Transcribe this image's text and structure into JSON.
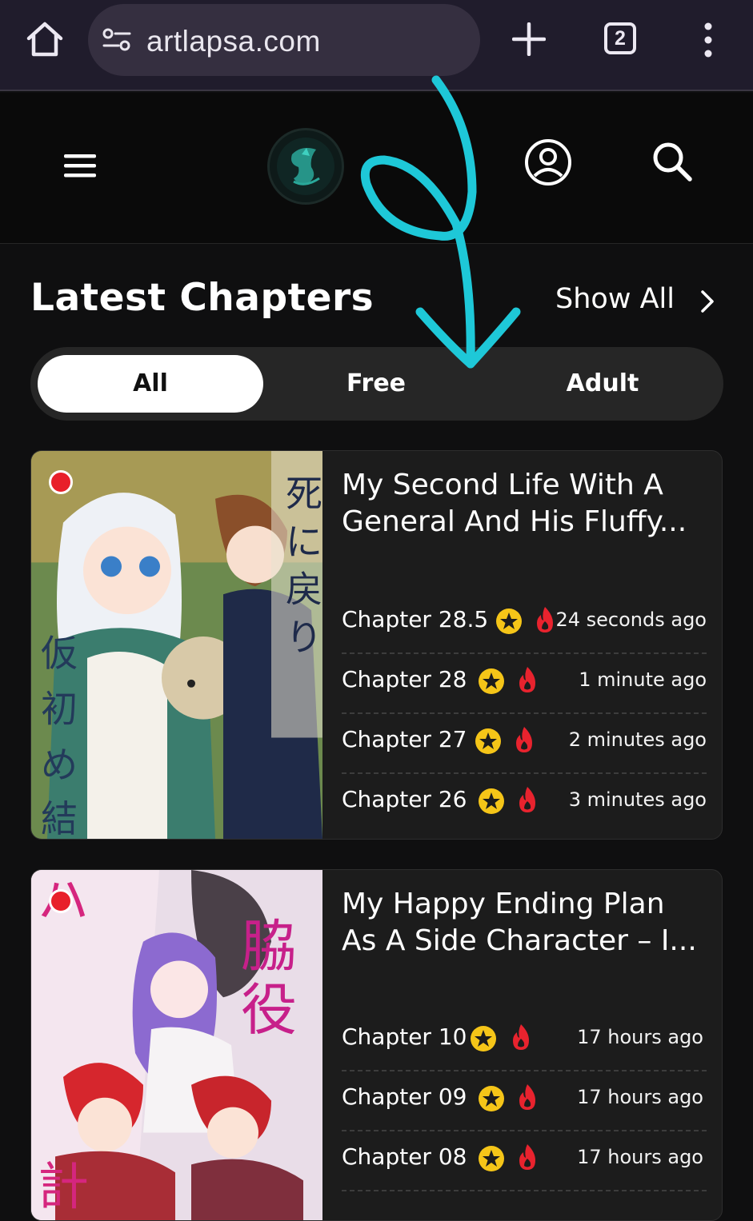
{
  "browser": {
    "url": "artlapsa.com",
    "tab_count": "2",
    "icons": [
      "home-icon",
      "site-settings-icon",
      "plus-icon",
      "tabs-icon",
      "more-vert-icon"
    ]
  },
  "header": {
    "icons": [
      "hamburger-menu-icon",
      "site-logo",
      "account-icon",
      "search-icon"
    ]
  },
  "section": {
    "title": "Latest Chapters",
    "show_all": "Show All"
  },
  "filters": {
    "tabs": [
      {
        "label": "All",
        "active": true
      },
      {
        "label": "Free",
        "active": false
      },
      {
        "label": "Adult",
        "active": false
      }
    ]
  },
  "series": [
    {
      "title": "My Second Life With A General And His Fluffy...",
      "chapters": [
        {
          "label": "Chapter 28.5",
          "time": "24 seconds ago"
        },
        {
          "label": "Chapter 28",
          "time": "1 minute ago"
        },
        {
          "label": "Chapter 27",
          "time": "2 minutes ago"
        },
        {
          "label": "Chapter 26",
          "time": "3 minutes ago"
        }
      ]
    },
    {
      "title": "My Happy Ending Plan As A Side Character – I...",
      "chapters": [
        {
          "label": "Chapter 10",
          "time": "17 hours ago"
        },
        {
          "label": "Chapter 09",
          "time": "17 hours ago"
        },
        {
          "label": "Chapter 08",
          "time": "17 hours ago"
        }
      ]
    }
  ],
  "colors": {
    "background": "#0f0f10",
    "browser_bar": "#201c2c",
    "star": "#f5c518",
    "fire": "#e8232e",
    "annotation": "#1ec8d8"
  }
}
